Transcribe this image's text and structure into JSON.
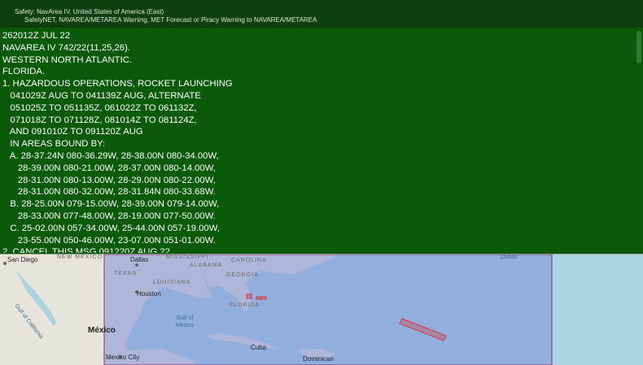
{
  "header": {
    "line1": "Safety: NavArea IV, United States of America (East)",
    "line2": "SafetyNET, NAVAREA/METAREA Warning, MET Forecast or Piracy Warning to NAVAREA/METAREA"
  },
  "message": {
    "text": "262012Z JUL 22\nNAVAREA IV 742/22(11,25,26).\nWESTERN NORTH ATLANTIC.\nFLORIDA.\n1. HAZARDOUS OPERATIONS, ROCKET LAUNCHING\n   041029Z AUG TO 041139Z AUG, ALTERNATE\n   051025Z TO 051135Z, 061022Z TO 061132Z,\n   071018Z TO 071128Z, 081014Z TO 081124Z,\n   AND 091010Z TO 091120Z AUG\n   IN AREAS BOUND BY:\n   A. 28-37.24N 080-36.29W, 28-38.00N 080-34.00W,\n      28-39.00N 080-21.00W, 28-37.00N 080-14.00W,\n      28-31.00N 080-13.00W, 28-29.00N 080-22.00W,\n      28-31.00N 080-32.00W, 28-31.84N 080-33.68W.\n   B. 28-25.00N 079-15.00W, 28-39.00N 079-14.00W,\n      28-33.00N 077-48.00W, 28-19.00N 077-50.00W.\n   C. 25-02.00N 057-34.00W, 25-44.00N 057-19.00W,\n      23-55.00N 050-46.00W, 23-07.00N 051-01.00W.\n2. CANCEL THIS MSG 091220Z AUG 22."
  },
  "map": {
    "labels": {
      "san_diego": "San Diego",
      "new_mexico": "NEW MEXICO",
      "dallas": "Dallas",
      "mississippi": "MISSISSIPPI",
      "carolina": "CAROLINA",
      "alabama": "ALABAMA",
      "georgia": "GEORGIA",
      "texas": "TEXAS",
      "louisiana": "LOUISIANA",
      "houston": "Houston",
      "florida": "FLORIDA",
      "gulf_of_california": "Gulf of California",
      "gulf_of_mexico": "Gulf of Mexico",
      "mexico": "México",
      "cuba": "Cuba",
      "mexico_city": "Mexico City",
      "dominican": "Dominican",
      "ocean": "Ocean"
    },
    "colors": {
      "navarea_overlay": "#7f8fd9",
      "warning_area": "#d33a3a",
      "land": "#e7e4dc",
      "water": "#a9d3df"
    }
  }
}
